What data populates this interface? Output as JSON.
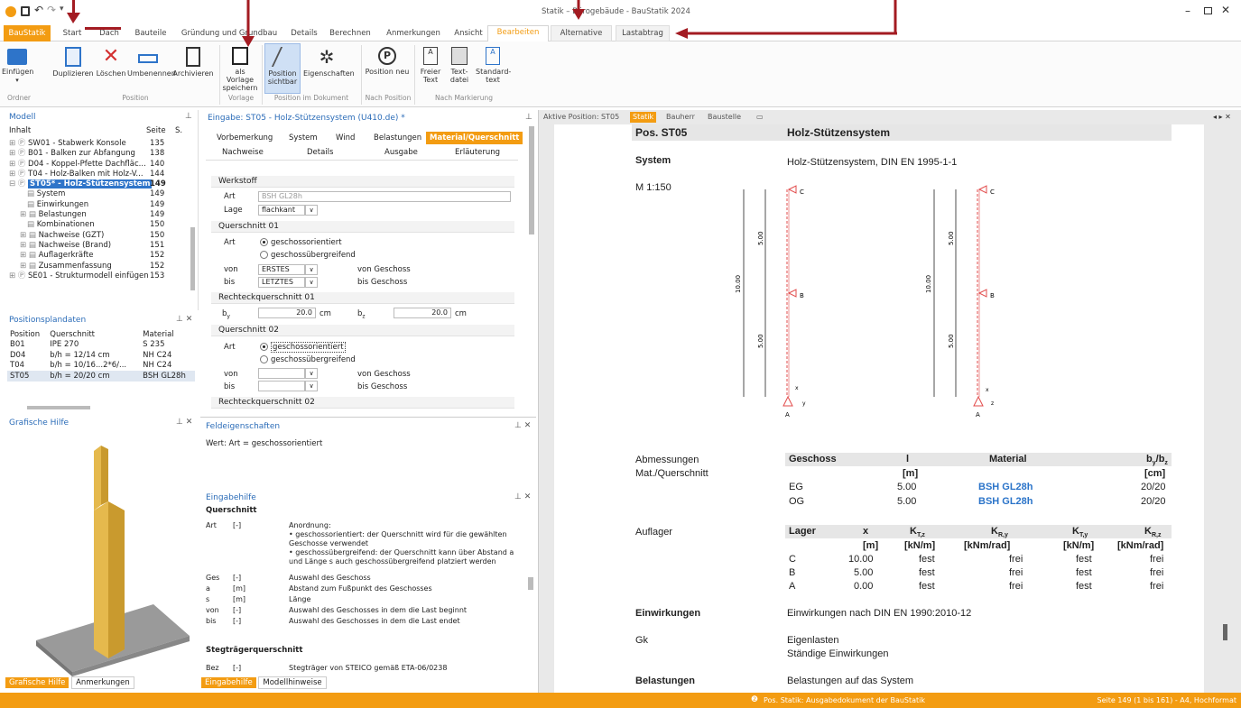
{
  "app": {
    "title": "Statik – Bürogebäude - BauStatik 2024",
    "help": "?"
  },
  "tabs": [
    "BauStatik",
    "Start",
    "Dach",
    "Bauteile",
    "Gründung und Grundbau",
    "Details",
    "Berechnen",
    "Anmerkungen",
    "Ansicht",
    "Bearbeiten",
    "Alternative",
    "Lastabtrag"
  ],
  "ribbon": {
    "buttons": [
      "Einfügen",
      "Duplizieren",
      "Löschen",
      "Umbenennen",
      "Archivieren",
      "als Vorlage speichern",
      "Position sichtbar",
      "Eigenschaften",
      "Position neu",
      "Freier Text",
      "Text-datei",
      "Standard-text"
    ],
    "groups": [
      "Ordner",
      "Position",
      "Vorlage",
      "Position im Dokument",
      "Nach Position",
      "Nach Markierung"
    ]
  },
  "modell": {
    "title": "Modell",
    "header": {
      "col1": "Inhalt",
      "col2": "Seite",
      "col3": "S."
    },
    "items": [
      {
        "label": "SW01 - Stabwerk Konsole",
        "page": "135"
      },
      {
        "label": "B01 - Balken zur Abfangung",
        "page": "138"
      },
      {
        "label": "D04 - Koppel-Pfette Dachfläc...",
        "page": "140"
      },
      {
        "label": "T04 - Holz-Balken mit Holz-V...",
        "page": "144"
      },
      {
        "label": "ST05* - Holz-Stützensystem",
        "page": "149"
      },
      {
        "label": "System",
        "page": "149"
      },
      {
        "label": "Einwirkungen",
        "page": "149"
      },
      {
        "label": "Belastungen",
        "page": "149"
      },
      {
        "label": "Kombinationen",
        "page": "150"
      },
      {
        "label": "Nachweise (GZT)",
        "page": "150"
      },
      {
        "label": "Nachweise (Brand)",
        "page": "151"
      },
      {
        "label": "Auflagerkräfte",
        "page": "152"
      },
      {
        "label": "Zusammenfassung",
        "page": "152"
      },
      {
        "label": "SE01 - Strukturmodell einfügen",
        "page": "153"
      }
    ]
  },
  "plandaten": {
    "title": "Positionsplandaten",
    "headers": [
      "Position",
      "Querschnitt",
      "Material"
    ],
    "rows": [
      [
        "B01",
        "IPE 270",
        "S 235"
      ],
      [
        "D04",
        "b/h = 12/14 cm",
        "NH C24"
      ],
      [
        "T04",
        "b/h = 10/16...2*6/...",
        "NH C24"
      ],
      [
        "ST05",
        "b/h = 20/20 cm",
        "BSH GL28h"
      ]
    ]
  },
  "grafik": {
    "title": "Grafische Hilfe",
    "tabs": [
      "Grafische Hilfe",
      "Anmerkungen"
    ]
  },
  "eingabe": {
    "title": "Eingabe: ST05 - Holz-Stützensystem (U410.de) *",
    "tabs_row1": [
      "Vorbemerkung",
      "System",
      "Wind",
      "Belastungen",
      "Material/Querschnitt"
    ],
    "tabs_row2": [
      "Nachweise",
      "Details",
      "Ausgabe",
      "Erläuterung"
    ],
    "werkstoff": {
      "title": "Werkstoff",
      "art_label": "Art",
      "art_value": "BSH GL28h",
      "lage_label": "Lage",
      "lage_value": "flachkant"
    },
    "qs01": {
      "title": "Querschnitt 01",
      "art_label": "Art",
      "opt1": "geschossorientiert",
      "opt2": "geschossübergreifend",
      "von_label": "von",
      "von_value": "ERSTES",
      "von_text": "von Geschoss",
      "bis_label": "bis",
      "bis_value": "LETZTES",
      "bis_text": "bis Geschoss"
    },
    "rq01": {
      "title": "Rechteckquerschnitt 01",
      "by_label": "b",
      "by_sub": "y",
      "by_value": "20.0",
      "by_unit": "cm",
      "bz_label": "b",
      "bz_sub": "z",
      "bz_value": "20.0",
      "bz_unit": "cm"
    },
    "qs02": {
      "title": "Querschnitt 02",
      "art_label": "Art",
      "opt1": "geschossorientiert",
      "opt2": "geschossübergreifend",
      "von_label": "von",
      "von_text": "von Geschoss",
      "bis_label": "bis",
      "bis_text": "bis Geschoss"
    },
    "rq02": {
      "title": "Rechteckquerschnitt 02"
    }
  },
  "feld": {
    "title": "Feldeigenschaften",
    "text": "Wert: Art = geschossorientiert"
  },
  "hilfe": {
    "title": "Eingabehilfe",
    "section": "Querschnitt",
    "rows": [
      {
        "k": "Art",
        "u": "[-]",
        "d": "Anordnung:\n• geschossorientiert: der Querschnitt wird für die gewählten Geschosse verwendet\n• geschossübergreifend: der Querschnitt kann über Abstand a und Länge s auch geschossübergreifend platziert werden"
      },
      {
        "k": "Ges",
        "u": "[-]",
        "d": "Auswahl des Geschoss"
      },
      {
        "k": "a",
        "u": "[m]",
        "d": "Abstand zum Fußpunkt des Geschosses"
      },
      {
        "k": "s",
        "u": "[m]",
        "d": "Länge"
      },
      {
        "k": "von",
        "u": "[-]",
        "d": "Auswahl des Geschosses in dem die Last beginnt"
      },
      {
        "k": "bis",
        "u": "[-]",
        "d": "Auswahl des Geschosses in dem die Last endet"
      }
    ],
    "section2": "Stegträgerquerschnitt",
    "bez_k": "Bez",
    "bez_u": "[-]",
    "bez_d": "Stegträger von STEICO gemäß ETA-06/0238",
    "tabs": [
      "Eingabehilfe",
      "Modellhinweise"
    ]
  },
  "doc": {
    "tabs": [
      "Aktive Position: ST05",
      "Statik",
      "Bauherr",
      "Baustelle"
    ],
    "pos_label": "Pos. ST05",
    "pos_title": "Holz-Stützensystem",
    "system_label": "System",
    "system_text": "Holz-Stützensystem, DIN EN 1995-1-1",
    "scale": "M 1:150",
    "dims": {
      "total": "10.00",
      "upper": "5.00",
      "lower": "5.00"
    },
    "nodes": [
      "C",
      "B",
      "A"
    ],
    "axes": {
      "x": "x",
      "y": "y",
      "z": "z"
    },
    "abm_label1": "Abmessungen",
    "abm_label2": "Mat./Querschnitt",
    "abm_head": [
      "Geschoss",
      "l",
      "Material",
      "b"
    ],
    "abm_head_sub": "y",
    "abm_head_slash": "/b",
    "abm_head_sub2": "z",
    "abm_units": [
      "[m]",
      "[cm]"
    ],
    "abm_rows": [
      [
        "EG",
        "5.00",
        "BSH GL28h",
        "20/20"
      ],
      [
        "OG",
        "5.00",
        "BSH GL28h",
        "20/20"
      ]
    ],
    "auf_label": "Auflager",
    "auf_head": [
      "Lager",
      "x",
      "K",
      "K",
      "K",
      "K"
    ],
    "auf_sub": [
      "T,z",
      "R,y",
      "T,y",
      "R,z"
    ],
    "auf_units": [
      "[m]",
      "[kN/m]",
      "[kNm/rad]",
      "[kN/m]",
      "[kNm/rad]"
    ],
    "auf_rows": [
      [
        "C",
        "10.00",
        "fest",
        "frei",
        "fest",
        "frei"
      ],
      [
        "B",
        "5.00",
        "fest",
        "frei",
        "fest",
        "frei"
      ],
      [
        "A",
        "0.00",
        "fest",
        "frei",
        "fest",
        "frei"
      ]
    ],
    "einw_label": "Einwirkungen",
    "einw_text": "Einwirkungen nach DIN EN 1990:2010-12",
    "gk_label": "Gk",
    "gk_line1": "Eigenlasten",
    "gk_line2": "Ständige Einwirkungen",
    "bel_label": "Belastungen",
    "bel_text": "Belastungen auf das System"
  },
  "status": {
    "center": "Pos. Statik: Ausgabedokument der BauStatik",
    "right": "Seite 149 (1 bis 161) - A4, Hochformat"
  },
  "colors": {
    "accent": "#f39c12",
    "arrow": "#a31b22",
    "link": "#2b74c9",
    "node": "#e24b4b"
  }
}
